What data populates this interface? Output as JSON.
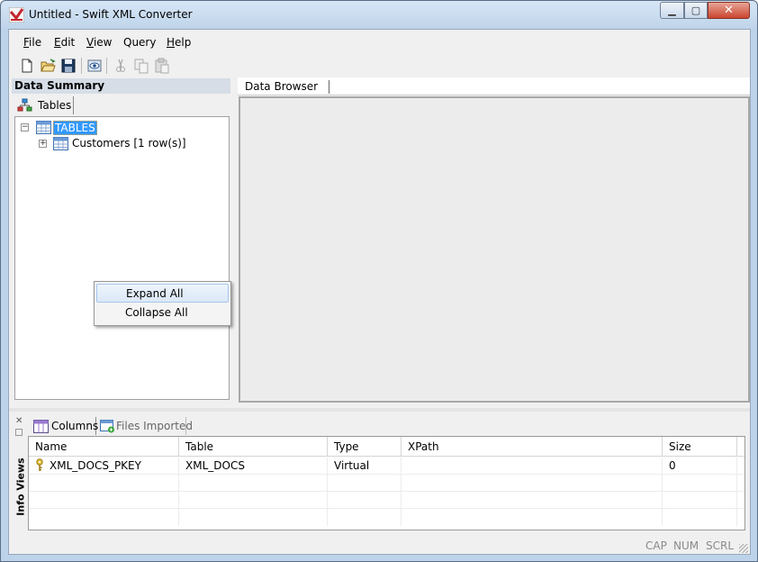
{
  "window": {
    "title": "Untitled - Swift XML Converter"
  },
  "menu": {
    "items": [
      {
        "accel": "F",
        "rest": "ile"
      },
      {
        "accel": "E",
        "rest": "dit"
      },
      {
        "accel": "V",
        "rest": "iew"
      },
      {
        "accel": "",
        "rest": "Query"
      },
      {
        "accel": "H",
        "rest": "elp"
      }
    ]
  },
  "toolbar": {
    "icons": [
      "new-file-icon",
      "open-folder-icon",
      "save-icon",
      "preview-icon",
      "cut-icon",
      "copy-icon",
      "paste-icon"
    ]
  },
  "left_pane": {
    "header": "Data Summary",
    "tab": "Tables",
    "tree": {
      "root": "TABLES",
      "child": "Customers [1 row(s)]"
    }
  },
  "context_menu": {
    "items": [
      "Expand All",
      "Collapse All"
    ]
  },
  "right_pane": {
    "tab": "Data Browser"
  },
  "info_views": {
    "side_label": "Info Views",
    "tabs": [
      "Columns",
      "Files Imported"
    ],
    "columns": [
      "Name",
      "Table",
      "Type",
      "XPath",
      "Size"
    ],
    "rows": [
      {
        "name": "XML_DOCS_PKEY",
        "table": "XML_DOCS",
        "type": "Virtual",
        "xpath": "",
        "size": "0"
      }
    ]
  },
  "status": {
    "indicators": [
      "CAP",
      "NUM",
      "SCRL"
    ]
  }
}
